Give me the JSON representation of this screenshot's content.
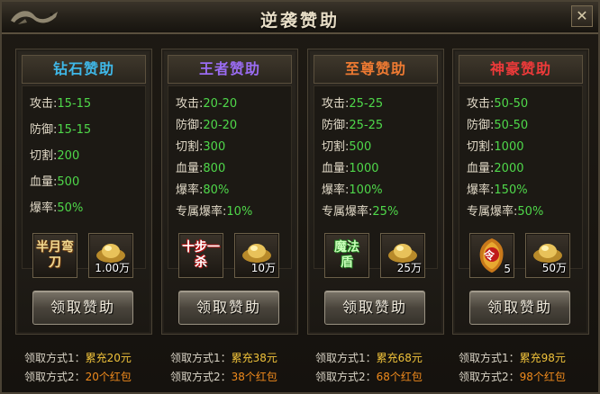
{
  "window": {
    "title": "逆袭赞助",
    "close_label": "✕"
  },
  "colors": {
    "diamond": "#3fb8e8",
    "king": "#9a6cf2",
    "supreme": "#ee7a32",
    "tycoon": "#ee3a3a",
    "stat_value": "#4fd84a",
    "method_gold": "#f0c23a",
    "method_orange": "#f08a1c"
  },
  "panels": [
    {
      "title": "钻石赞助",
      "stats": [
        {
          "label": "攻击",
          "value": "15-15"
        },
        {
          "label": "防御",
          "value": "15-15"
        },
        {
          "label": "切割",
          "value": "200"
        },
        {
          "label": "血量",
          "value": "500"
        },
        {
          "label": "爆率",
          "value": "50%"
        }
      ],
      "item1": {
        "icon": "crescent-blade-icon",
        "text": "半月弯刀"
      },
      "item2": {
        "icon": "gold-ingot-icon",
        "count": "1.00万"
      },
      "button": "领取赞助",
      "method1": {
        "label": "领取方式1：",
        "value": "累充20元"
      },
      "method2": {
        "label": "领取方式2：",
        "value": "20个红包"
      }
    },
    {
      "title": "王者赞助",
      "stats": [
        {
          "label": "攻击",
          "value": "20-20"
        },
        {
          "label": "防御",
          "value": "20-20"
        },
        {
          "label": "切割",
          "value": "300"
        },
        {
          "label": "血量",
          "value": "800"
        },
        {
          "label": "爆率",
          "value": "80%"
        },
        {
          "label": "专属爆率",
          "value": "10%"
        }
      ],
      "item1": {
        "icon": "ten-step-kill-icon",
        "text": "十步一杀"
      },
      "item2": {
        "icon": "gold-ingot-icon",
        "count": "10万"
      },
      "button": "领取赞助",
      "method1": {
        "label": "领取方式1：",
        "value": "累充38元"
      },
      "method2": {
        "label": "领取方式2：",
        "value": "38个红包"
      }
    },
    {
      "title": "至尊赞助",
      "stats": [
        {
          "label": "攻击",
          "value": "25-25"
        },
        {
          "label": "防御",
          "value": "25-25"
        },
        {
          "label": "切割",
          "value": "500"
        },
        {
          "label": "血量",
          "value": "1000"
        },
        {
          "label": "爆率",
          "value": "100%"
        },
        {
          "label": "专属爆率",
          "value": "25%"
        }
      ],
      "item1": {
        "icon": "magic-shield-icon",
        "text": "魔法盾"
      },
      "item2": {
        "icon": "gold-ingot-icon",
        "count": "25万"
      },
      "button": "领取赞助",
      "method1": {
        "label": "领取方式1：",
        "value": "累充68元"
      },
      "method2": {
        "label": "领取方式2：",
        "value": "68个红包"
      }
    },
    {
      "title": "神豪赞助",
      "stats": [
        {
          "label": "攻击",
          "value": "50-50"
        },
        {
          "label": "防御",
          "value": "50-50"
        },
        {
          "label": "切割",
          "value": "1000"
        },
        {
          "label": "血量",
          "value": "2000"
        },
        {
          "label": "爆率",
          "value": "150%"
        },
        {
          "label": "专属爆率",
          "value": "50%"
        }
      ],
      "item1": {
        "icon": "dragon-token-icon",
        "text": "令",
        "count": "5"
      },
      "item2": {
        "icon": "gold-ingot-icon",
        "count": "50万"
      },
      "button": "领取赞助",
      "method1": {
        "label": "领取方式1：",
        "value": "累充98元"
      },
      "method2": {
        "label": "领取方式2：",
        "value": "98个红包"
      }
    }
  ]
}
